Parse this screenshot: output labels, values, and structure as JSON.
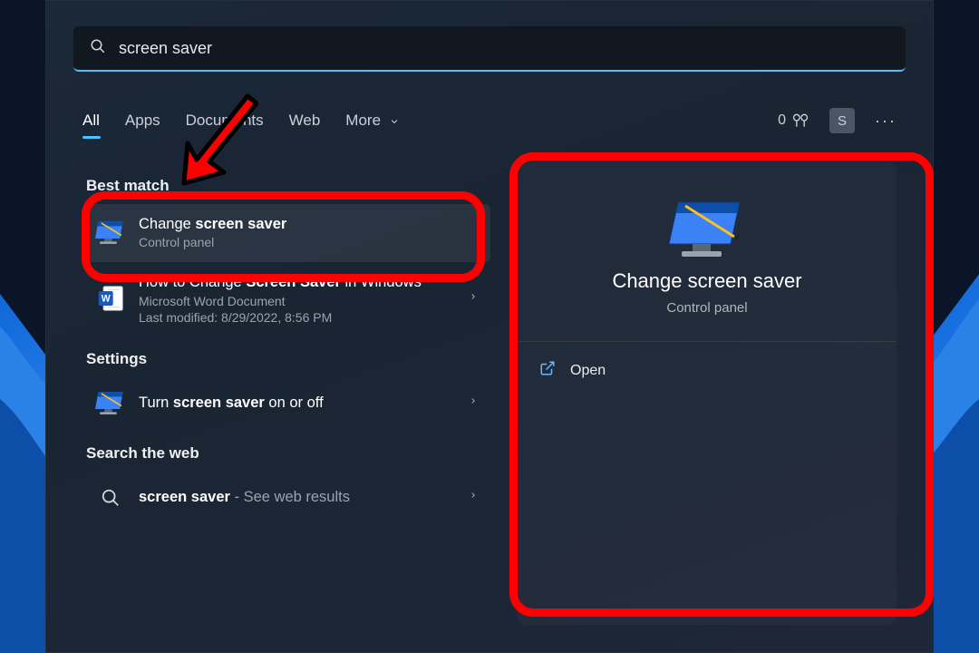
{
  "search": {
    "query": "screen saver"
  },
  "tabs": {
    "items": [
      "All",
      "Apps",
      "Documents",
      "Web",
      "More"
    ],
    "active_index": 0
  },
  "header_right": {
    "rewards_count": "0",
    "avatar_letter": "S",
    "more": "···"
  },
  "sections": {
    "best_match": {
      "label": "Best match",
      "result": {
        "title_pre": "Change ",
        "title_bold": "screen saver",
        "title_post": "",
        "subtitle": "Control panel"
      }
    },
    "doc_result": {
      "title_pre": "How to Change ",
      "title_bold": "Screen Saver",
      "title_post": " in Windows",
      "subtitle": "Microsoft Word Document",
      "subtitle2": "Last modified: 8/29/2022, 8:56 PM"
    },
    "settings": {
      "label": "Settings",
      "result": {
        "title_pre": "Turn ",
        "title_bold": "screen saver",
        "title_post": " on or off"
      }
    },
    "web": {
      "label": "Search the web",
      "result": {
        "term": "screen saver",
        "suffix": " - See web results"
      }
    }
  },
  "preview": {
    "title": "Change screen saver",
    "subtitle": "Control panel",
    "action": "Open"
  }
}
